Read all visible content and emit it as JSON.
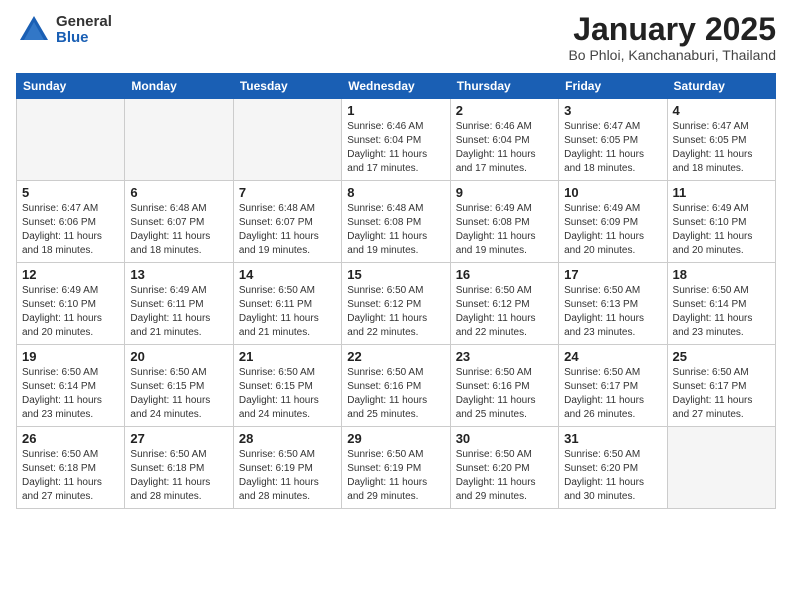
{
  "logo": {
    "general": "General",
    "blue": "Blue"
  },
  "header": {
    "month": "January 2025",
    "location": "Bo Phloi, Kanchanaburi, Thailand"
  },
  "weekdays": [
    "Sunday",
    "Monday",
    "Tuesday",
    "Wednesday",
    "Thursday",
    "Friday",
    "Saturday"
  ],
  "weeks": [
    [
      {
        "day": null
      },
      {
        "day": null
      },
      {
        "day": null
      },
      {
        "day": "1",
        "sunrise": "6:46 AM",
        "sunset": "6:04 PM",
        "daylight": "11 hours and 17 minutes."
      },
      {
        "day": "2",
        "sunrise": "6:46 AM",
        "sunset": "6:04 PM",
        "daylight": "11 hours and 17 minutes."
      },
      {
        "day": "3",
        "sunrise": "6:47 AM",
        "sunset": "6:05 PM",
        "daylight": "11 hours and 18 minutes."
      },
      {
        "day": "4",
        "sunrise": "6:47 AM",
        "sunset": "6:05 PM",
        "daylight": "11 hours and 18 minutes."
      }
    ],
    [
      {
        "day": "5",
        "sunrise": "6:47 AM",
        "sunset": "6:06 PM",
        "daylight": "11 hours and 18 minutes."
      },
      {
        "day": "6",
        "sunrise": "6:48 AM",
        "sunset": "6:07 PM",
        "daylight": "11 hours and 18 minutes."
      },
      {
        "day": "7",
        "sunrise": "6:48 AM",
        "sunset": "6:07 PM",
        "daylight": "11 hours and 19 minutes."
      },
      {
        "day": "8",
        "sunrise": "6:48 AM",
        "sunset": "6:08 PM",
        "daylight": "11 hours and 19 minutes."
      },
      {
        "day": "9",
        "sunrise": "6:49 AM",
        "sunset": "6:08 PM",
        "daylight": "11 hours and 19 minutes."
      },
      {
        "day": "10",
        "sunrise": "6:49 AM",
        "sunset": "6:09 PM",
        "daylight": "11 hours and 20 minutes."
      },
      {
        "day": "11",
        "sunrise": "6:49 AM",
        "sunset": "6:10 PM",
        "daylight": "11 hours and 20 minutes."
      }
    ],
    [
      {
        "day": "12",
        "sunrise": "6:49 AM",
        "sunset": "6:10 PM",
        "daylight": "11 hours and 20 minutes."
      },
      {
        "day": "13",
        "sunrise": "6:49 AM",
        "sunset": "6:11 PM",
        "daylight": "11 hours and 21 minutes."
      },
      {
        "day": "14",
        "sunrise": "6:50 AM",
        "sunset": "6:11 PM",
        "daylight": "11 hours and 21 minutes."
      },
      {
        "day": "15",
        "sunrise": "6:50 AM",
        "sunset": "6:12 PM",
        "daylight": "11 hours and 22 minutes."
      },
      {
        "day": "16",
        "sunrise": "6:50 AM",
        "sunset": "6:12 PM",
        "daylight": "11 hours and 22 minutes."
      },
      {
        "day": "17",
        "sunrise": "6:50 AM",
        "sunset": "6:13 PM",
        "daylight": "11 hours and 23 minutes."
      },
      {
        "day": "18",
        "sunrise": "6:50 AM",
        "sunset": "6:14 PM",
        "daylight": "11 hours and 23 minutes."
      }
    ],
    [
      {
        "day": "19",
        "sunrise": "6:50 AM",
        "sunset": "6:14 PM",
        "daylight": "11 hours and 23 minutes."
      },
      {
        "day": "20",
        "sunrise": "6:50 AM",
        "sunset": "6:15 PM",
        "daylight": "11 hours and 24 minutes."
      },
      {
        "day": "21",
        "sunrise": "6:50 AM",
        "sunset": "6:15 PM",
        "daylight": "11 hours and 24 minutes."
      },
      {
        "day": "22",
        "sunrise": "6:50 AM",
        "sunset": "6:16 PM",
        "daylight": "11 hours and 25 minutes."
      },
      {
        "day": "23",
        "sunrise": "6:50 AM",
        "sunset": "6:16 PM",
        "daylight": "11 hours and 25 minutes."
      },
      {
        "day": "24",
        "sunrise": "6:50 AM",
        "sunset": "6:17 PM",
        "daylight": "11 hours and 26 minutes."
      },
      {
        "day": "25",
        "sunrise": "6:50 AM",
        "sunset": "6:17 PM",
        "daylight": "11 hours and 27 minutes."
      }
    ],
    [
      {
        "day": "26",
        "sunrise": "6:50 AM",
        "sunset": "6:18 PM",
        "daylight": "11 hours and 27 minutes."
      },
      {
        "day": "27",
        "sunrise": "6:50 AM",
        "sunset": "6:18 PM",
        "daylight": "11 hours and 28 minutes."
      },
      {
        "day": "28",
        "sunrise": "6:50 AM",
        "sunset": "6:19 PM",
        "daylight": "11 hours and 28 minutes."
      },
      {
        "day": "29",
        "sunrise": "6:50 AM",
        "sunset": "6:19 PM",
        "daylight": "11 hours and 29 minutes."
      },
      {
        "day": "30",
        "sunrise": "6:50 AM",
        "sunset": "6:20 PM",
        "daylight": "11 hours and 29 minutes."
      },
      {
        "day": "31",
        "sunrise": "6:50 AM",
        "sunset": "6:20 PM",
        "daylight": "11 hours and 30 minutes."
      },
      {
        "day": null
      }
    ]
  ],
  "labels": {
    "sunrise": "Sunrise:",
    "sunset": "Sunset:",
    "daylight": "Daylight:"
  }
}
